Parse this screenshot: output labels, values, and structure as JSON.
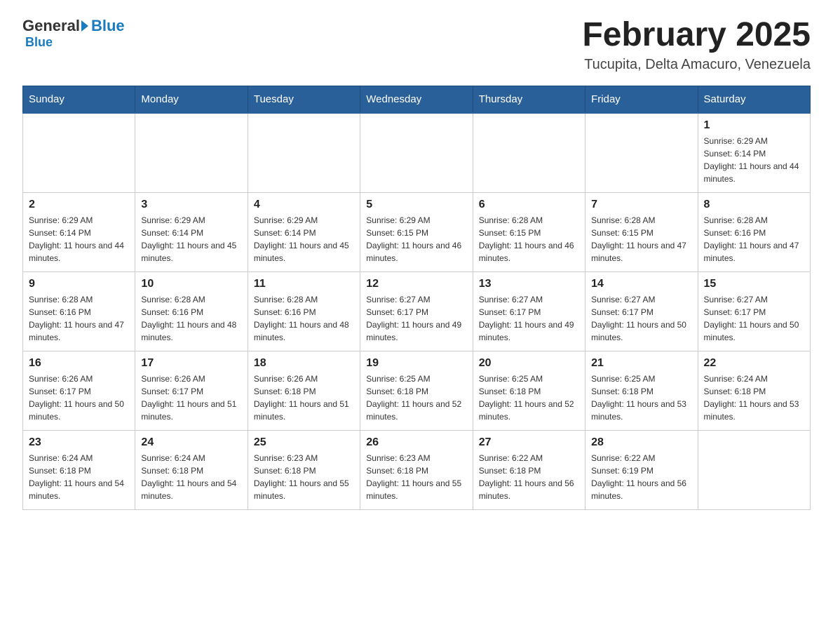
{
  "header": {
    "logo_general": "General",
    "logo_blue": "Blue",
    "month_title": "February 2025",
    "location": "Tucupita, Delta Amacuro, Venezuela"
  },
  "days_of_week": [
    "Sunday",
    "Monday",
    "Tuesday",
    "Wednesday",
    "Thursday",
    "Friday",
    "Saturday"
  ],
  "weeks": [
    [
      {
        "day": "",
        "sunrise": "",
        "sunset": "",
        "daylight": ""
      },
      {
        "day": "",
        "sunrise": "",
        "sunset": "",
        "daylight": ""
      },
      {
        "day": "",
        "sunrise": "",
        "sunset": "",
        "daylight": ""
      },
      {
        "day": "",
        "sunrise": "",
        "sunset": "",
        "daylight": ""
      },
      {
        "day": "",
        "sunrise": "",
        "sunset": "",
        "daylight": ""
      },
      {
        "day": "",
        "sunrise": "",
        "sunset": "",
        "daylight": ""
      },
      {
        "day": "1",
        "sunrise": "Sunrise: 6:29 AM",
        "sunset": "Sunset: 6:14 PM",
        "daylight": "Daylight: 11 hours and 44 minutes."
      }
    ],
    [
      {
        "day": "2",
        "sunrise": "Sunrise: 6:29 AM",
        "sunset": "Sunset: 6:14 PM",
        "daylight": "Daylight: 11 hours and 44 minutes."
      },
      {
        "day": "3",
        "sunrise": "Sunrise: 6:29 AM",
        "sunset": "Sunset: 6:14 PM",
        "daylight": "Daylight: 11 hours and 45 minutes."
      },
      {
        "day": "4",
        "sunrise": "Sunrise: 6:29 AM",
        "sunset": "Sunset: 6:14 PM",
        "daylight": "Daylight: 11 hours and 45 minutes."
      },
      {
        "day": "5",
        "sunrise": "Sunrise: 6:29 AM",
        "sunset": "Sunset: 6:15 PM",
        "daylight": "Daylight: 11 hours and 46 minutes."
      },
      {
        "day": "6",
        "sunrise": "Sunrise: 6:28 AM",
        "sunset": "Sunset: 6:15 PM",
        "daylight": "Daylight: 11 hours and 46 minutes."
      },
      {
        "day": "7",
        "sunrise": "Sunrise: 6:28 AM",
        "sunset": "Sunset: 6:15 PM",
        "daylight": "Daylight: 11 hours and 47 minutes."
      },
      {
        "day": "8",
        "sunrise": "Sunrise: 6:28 AM",
        "sunset": "Sunset: 6:16 PM",
        "daylight": "Daylight: 11 hours and 47 minutes."
      }
    ],
    [
      {
        "day": "9",
        "sunrise": "Sunrise: 6:28 AM",
        "sunset": "Sunset: 6:16 PM",
        "daylight": "Daylight: 11 hours and 47 minutes."
      },
      {
        "day": "10",
        "sunrise": "Sunrise: 6:28 AM",
        "sunset": "Sunset: 6:16 PM",
        "daylight": "Daylight: 11 hours and 48 minutes."
      },
      {
        "day": "11",
        "sunrise": "Sunrise: 6:28 AM",
        "sunset": "Sunset: 6:16 PM",
        "daylight": "Daylight: 11 hours and 48 minutes."
      },
      {
        "day": "12",
        "sunrise": "Sunrise: 6:27 AM",
        "sunset": "Sunset: 6:17 PM",
        "daylight": "Daylight: 11 hours and 49 minutes."
      },
      {
        "day": "13",
        "sunrise": "Sunrise: 6:27 AM",
        "sunset": "Sunset: 6:17 PM",
        "daylight": "Daylight: 11 hours and 49 minutes."
      },
      {
        "day": "14",
        "sunrise": "Sunrise: 6:27 AM",
        "sunset": "Sunset: 6:17 PM",
        "daylight": "Daylight: 11 hours and 50 minutes."
      },
      {
        "day": "15",
        "sunrise": "Sunrise: 6:27 AM",
        "sunset": "Sunset: 6:17 PM",
        "daylight": "Daylight: 11 hours and 50 minutes."
      }
    ],
    [
      {
        "day": "16",
        "sunrise": "Sunrise: 6:26 AM",
        "sunset": "Sunset: 6:17 PM",
        "daylight": "Daylight: 11 hours and 50 minutes."
      },
      {
        "day": "17",
        "sunrise": "Sunrise: 6:26 AM",
        "sunset": "Sunset: 6:17 PM",
        "daylight": "Daylight: 11 hours and 51 minutes."
      },
      {
        "day": "18",
        "sunrise": "Sunrise: 6:26 AM",
        "sunset": "Sunset: 6:18 PM",
        "daylight": "Daylight: 11 hours and 51 minutes."
      },
      {
        "day": "19",
        "sunrise": "Sunrise: 6:25 AM",
        "sunset": "Sunset: 6:18 PM",
        "daylight": "Daylight: 11 hours and 52 minutes."
      },
      {
        "day": "20",
        "sunrise": "Sunrise: 6:25 AM",
        "sunset": "Sunset: 6:18 PM",
        "daylight": "Daylight: 11 hours and 52 minutes."
      },
      {
        "day": "21",
        "sunrise": "Sunrise: 6:25 AM",
        "sunset": "Sunset: 6:18 PM",
        "daylight": "Daylight: 11 hours and 53 minutes."
      },
      {
        "day": "22",
        "sunrise": "Sunrise: 6:24 AM",
        "sunset": "Sunset: 6:18 PM",
        "daylight": "Daylight: 11 hours and 53 minutes."
      }
    ],
    [
      {
        "day": "23",
        "sunrise": "Sunrise: 6:24 AM",
        "sunset": "Sunset: 6:18 PM",
        "daylight": "Daylight: 11 hours and 54 minutes."
      },
      {
        "day": "24",
        "sunrise": "Sunrise: 6:24 AM",
        "sunset": "Sunset: 6:18 PM",
        "daylight": "Daylight: 11 hours and 54 minutes."
      },
      {
        "day": "25",
        "sunrise": "Sunrise: 6:23 AM",
        "sunset": "Sunset: 6:18 PM",
        "daylight": "Daylight: 11 hours and 55 minutes."
      },
      {
        "day": "26",
        "sunrise": "Sunrise: 6:23 AM",
        "sunset": "Sunset: 6:18 PM",
        "daylight": "Daylight: 11 hours and 55 minutes."
      },
      {
        "day": "27",
        "sunrise": "Sunrise: 6:22 AM",
        "sunset": "Sunset: 6:18 PM",
        "daylight": "Daylight: 11 hours and 56 minutes."
      },
      {
        "day": "28",
        "sunrise": "Sunrise: 6:22 AM",
        "sunset": "Sunset: 6:19 PM",
        "daylight": "Daylight: 11 hours and 56 minutes."
      },
      {
        "day": "",
        "sunrise": "",
        "sunset": "",
        "daylight": ""
      }
    ]
  ]
}
